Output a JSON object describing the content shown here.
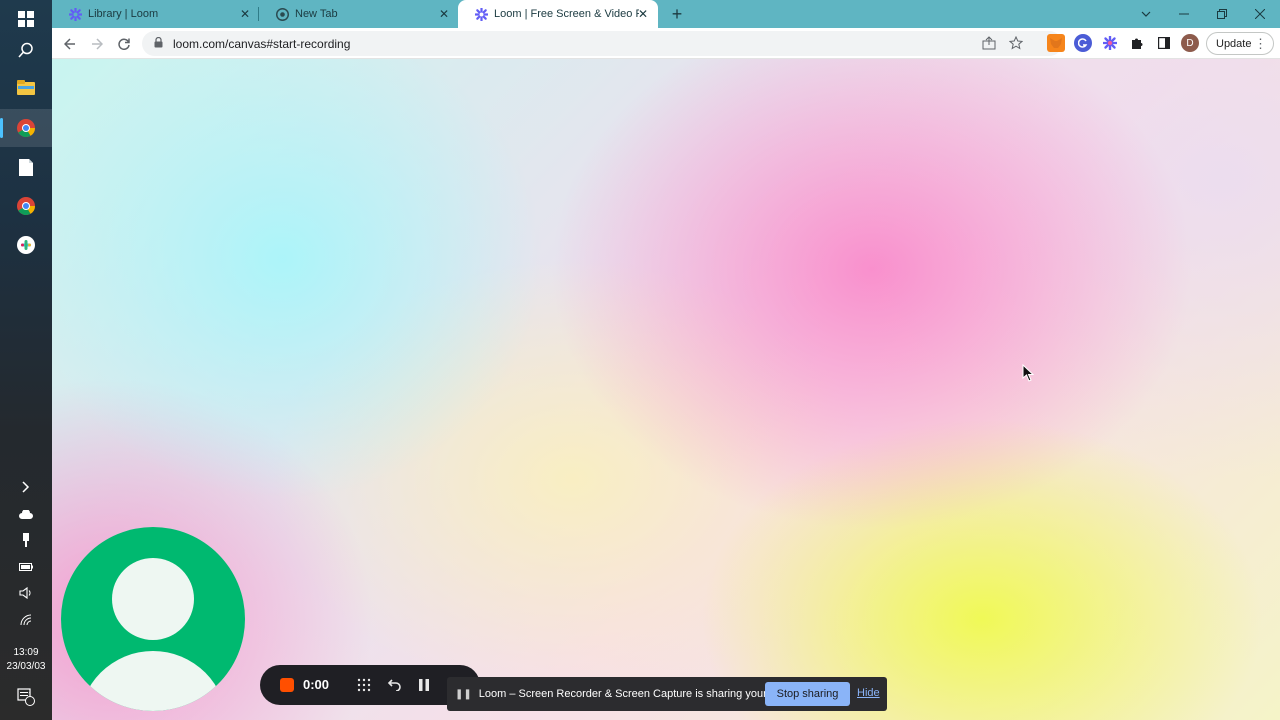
{
  "taskbar": {
    "apps": [
      {
        "name": "windows-start",
        "icon": "windows-logo-icon"
      },
      {
        "name": "search",
        "icon": "search-icon"
      },
      {
        "name": "file-explorer",
        "icon": "folder-icon"
      },
      {
        "name": "chrome-profile",
        "icon": "chrome-icon"
      },
      {
        "name": "notepad",
        "icon": "document-icon"
      },
      {
        "name": "chrome",
        "icon": "chrome-icon"
      },
      {
        "name": "slack",
        "icon": "slack-icon"
      }
    ],
    "time": "13:09",
    "date": "23/03/03",
    "notification_count": "1"
  },
  "browser": {
    "tabs": [
      {
        "title": "Library | Loom",
        "favicon": "loom-icon",
        "active": false
      },
      {
        "title": "New Tab",
        "favicon": "chrome-icon",
        "active": false
      },
      {
        "title": "Loom | Free Screen & Video Rec",
        "favicon": "loom-icon",
        "active": true
      }
    ],
    "new_tab_label": "+",
    "url": "loom.com/canvas#start-recording",
    "profile_initial": "D",
    "update_label": "Update",
    "extensions": [
      "metamask-icon",
      "grammarly-icon",
      "loom-icon",
      "puzzle-icon",
      "sidepanel-icon"
    ],
    "colors": {
      "tabstrip": "#5fb5c2",
      "accent": "#8ab4f8"
    }
  },
  "recorder": {
    "timer": "0:00",
    "stop_color": "#ff4f00",
    "camera_color": "#00b970"
  },
  "share_banner": {
    "message": "Loom – Screen Recorder & Screen Capture is sharing your screen.",
    "stop_label": "Stop sharing",
    "hide_label": "Hide"
  }
}
